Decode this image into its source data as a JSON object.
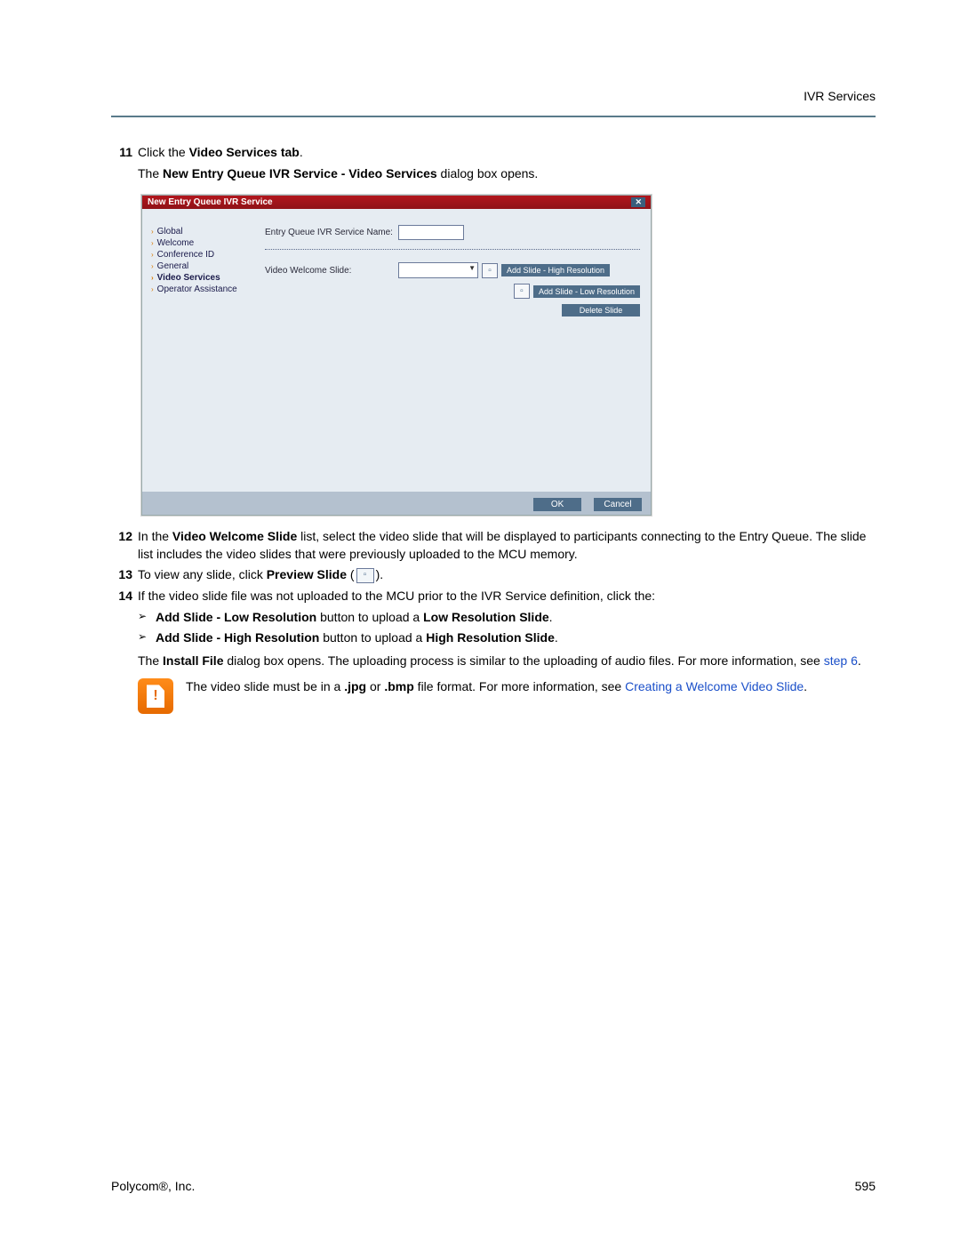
{
  "header": {
    "right": "IVR Services"
  },
  "steps": {
    "s11": {
      "num": "11",
      "t1": "Click the ",
      "b1": "Video Services tab",
      "t2": ".",
      "line2_t1": "The ",
      "line2_b1": "New Entry Queue IVR Service - Video Services",
      "line2_t2": " dialog box opens."
    },
    "s12": {
      "num": "12",
      "t1": "In the ",
      "b1": "Video Welcome Slide",
      "t2": " list, select the video slide that will be displayed to participants connecting to the Entry Queue. The slide list includes the video slides that were previously uploaded to the MCU memory."
    },
    "s13": {
      "num": "13",
      "t1": "To view any slide, click ",
      "b1": "Preview Slide",
      "t2": " (",
      "t3": ")."
    },
    "s14": {
      "num": "14",
      "t1": "If the video slide file was not uploaded to the MCU prior to the IVR Service definition, click the:"
    },
    "b_low": {
      "b1": "Add Slide - Low Resolution",
      "t1": " button to upload a ",
      "b2": "Low Resolution Slide",
      "t2": "."
    },
    "b_high": {
      "b1": "Add Slide - High Resolution",
      "t1": " button to upload a ",
      "b2": "High Resolution Slide",
      "t2": "."
    },
    "after": {
      "t1": "The ",
      "b1": "Install File",
      "t2": " dialog box opens. The uploading process is similar to the uploading of audio files. For more information, see ",
      "link": "step 6",
      "t3": "."
    }
  },
  "note": {
    "t1": "The video slide must be in a ",
    "b1": ".jpg",
    "t2": " or ",
    "b2": ".bmp",
    "t3": " file format. For more information, see ",
    "link": "Creating a Welcome Video Slide",
    "t4": "."
  },
  "dialog": {
    "title": "New Entry Queue IVR Service",
    "sidebar": [
      "Global",
      "Welcome",
      "Conference ID",
      "General",
      "Video Services",
      "Operator Assistance"
    ],
    "selected_idx": 4,
    "label_name": "Entry Queue IVR Service Name:",
    "label_slide": "Video Welcome Slide:",
    "btn_hi": "Add Slide - High Resolution",
    "btn_lo": "Add Slide - Low Resolution",
    "btn_del": "Delete Slide",
    "ok": "OK",
    "cancel": "Cancel"
  },
  "footer": {
    "left": "Polycom®, Inc.",
    "right": "595"
  },
  "glyphs": {
    "arrow": "›",
    "tri": "➢",
    "preview": "▫↗",
    "note": "!"
  }
}
